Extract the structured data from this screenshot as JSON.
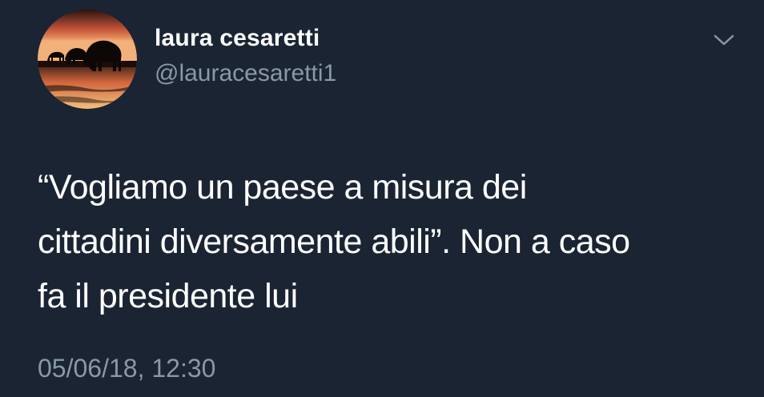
{
  "author": {
    "display_name": "laura cesaretti",
    "handle": "@lauracesaretti1",
    "avatar_icon": "elephants-sunset-avatar"
  },
  "tweet": {
    "text_lines": [
      "“Vogliamo un paese a misura dei",
      "cittadini diversamente abili”. Non a caso",
      "fa il presidente lui"
    ],
    "timestamp": "05/06/18, 12:30"
  },
  "menu": {
    "icon": "chevron-down-icon"
  },
  "colors": {
    "background": "#1b2433",
    "primary_text": "#ffffff",
    "secondary_text": "#8899a6"
  }
}
